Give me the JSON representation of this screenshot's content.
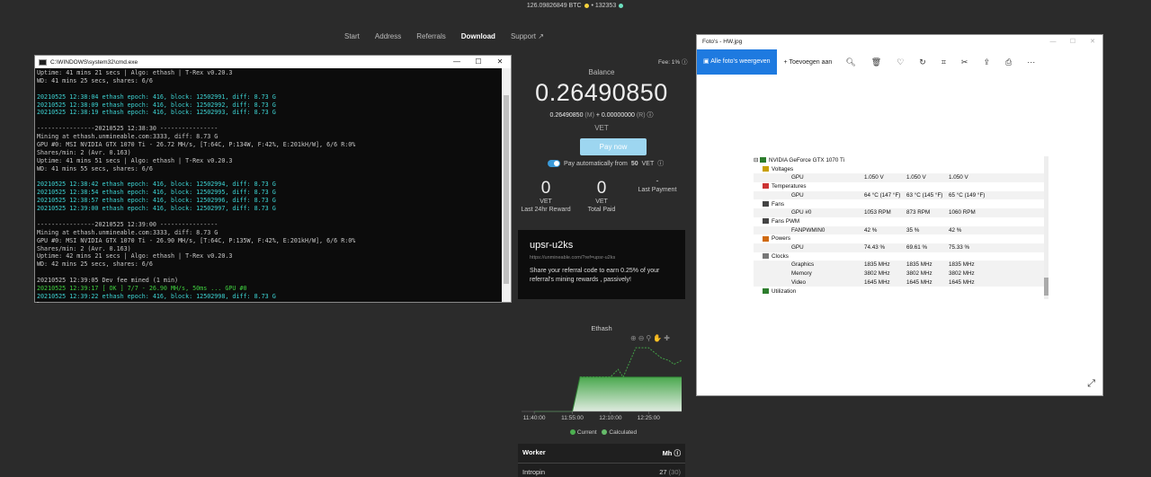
{
  "ticker": {
    "btc": "126.09826849 BTC",
    "sep": "•",
    "count": "132353"
  },
  "nav": {
    "items": [
      "Start",
      "Address",
      "Referrals",
      "Download",
      "Support"
    ]
  },
  "cmd": {
    "title": "C:\\WINDOWS\\system32\\cmd.exe",
    "lines": [
      {
        "t": "Uptime: 41 mins 21 secs | Algo: ethash | T-Rex v0.20.3",
        "c": "w"
      },
      {
        "t": "WD: 41 mins 25 secs, shares: 6/6",
        "c": "w"
      },
      {
        "t": "",
        "c": "w"
      },
      {
        "t": "20210525 12:38:04 ethash epoch: 416, block: 12502991, diff: 8.73 G",
        "c": "c"
      },
      {
        "t": "20210525 12:38:09 ethash epoch: 416, block: 12502992, diff: 8.73 G",
        "c": "c"
      },
      {
        "t": "20210525 12:38:19 ethash epoch: 416, block: 12502993, diff: 8.73 G",
        "c": "c"
      },
      {
        "t": "",
        "c": "w"
      },
      {
        "t": "----------------20210525 12:38:30 ----------------",
        "c": "w"
      },
      {
        "t": "Mining at ethash.unmineable.com:3333, diff: 8.73 G",
        "c": "w"
      },
      {
        "t": "GPU #0: MSI NVIDIA GTX 1070 Ti - 26.72 MH/s, [T:64C, P:134W, F:42%, E:201kH/W], 6/6 R:0%",
        "c": "w"
      },
      {
        "t": "Shares/min: 2 (Avr. 0.163)",
        "c": "w"
      },
      {
        "t": "Uptime: 41 mins 51 secs | Algo: ethash | T-Rex v0.20.3",
        "c": "w"
      },
      {
        "t": "WD: 41 mins 55 secs, shares: 6/6",
        "c": "w"
      },
      {
        "t": "",
        "c": "w"
      },
      {
        "t": "20210525 12:38:42 ethash epoch: 416, block: 12502994, diff: 8.73 G",
        "c": "c"
      },
      {
        "t": "20210525 12:38:54 ethash epoch: 416, block: 12502995, diff: 8.73 G",
        "c": "c"
      },
      {
        "t": "20210525 12:38:57 ethash epoch: 416, block: 12502996, diff: 8.73 G",
        "c": "c"
      },
      {
        "t": "20210525 12:39:00 ethash epoch: 416, block: 12502997, diff: 8.73 G",
        "c": "c"
      },
      {
        "t": "",
        "c": "w"
      },
      {
        "t": "----------------20210525 12:39:00 ----------------",
        "c": "w"
      },
      {
        "t": "Mining at ethash.unmineable.com:3333, diff: 8.73 G",
        "c": "w"
      },
      {
        "t": "GPU #0: MSI NVIDIA GTX 1070 Ti - 26.90 MH/s, [T:64C, P:135W, F:42%, E:201kH/W], 6/6 R:0%",
        "c": "w"
      },
      {
        "t": "Shares/min: 2 (Avr. 0.163)",
        "c": "w"
      },
      {
        "t": "Uptime: 42 mins 21 secs | Algo: ethash | T-Rex v0.20.3",
        "c": "w"
      },
      {
        "t": "WD: 42 mins 25 secs, shares: 6/6",
        "c": "w"
      },
      {
        "t": "",
        "c": "w"
      },
      {
        "t": "20210525 12:39:05 Dev fee mined (1 min)",
        "c": "w"
      },
      {
        "t": "20210525 12:39:17 [ OK ] 7/7 - 26.90 MH/s, 50ms ... GPU #0",
        "c": "g"
      },
      {
        "t": "20210525 12:39:22 ethash epoch: 416, block: 12502998, diff: 8.73 G",
        "c": "c"
      }
    ]
  },
  "balance": {
    "fee": "Fee: 1%",
    "label": "Balance",
    "value": "0.26490850",
    "sub_main": "0.26490850",
    "sub_m": "(M)",
    "sub_plus": "+ 0.00000000",
    "sub_r": "(R)",
    "unit": "VET",
    "pay_now": "Pay now",
    "autopay_prefix": "Pay automatically from",
    "autopay_amount": "50",
    "autopay_unit": "VET",
    "stats": [
      {
        "big": "0",
        "unit": "VET",
        "label": "Last 24hr Reward"
      },
      {
        "big": "0",
        "unit": "VET",
        "label": "Total Paid"
      },
      {
        "big": "-",
        "unit": "",
        "label": "Last Payment"
      }
    ]
  },
  "referral": {
    "code": "upsr-u2ks",
    "url": "https://unmineable.com/?ref=upsr-u2ks",
    "text": "Share your referral code to earn 0.25% of your referral's mining rewards , passively!"
  },
  "chart_data": {
    "type": "area",
    "title": "Ethash",
    "x_ticks": [
      "11:40:00",
      "11:55:00",
      "12:10:00",
      "12:25:00"
    ],
    "series": [
      {
        "name": "Current",
        "color": "#4caf50",
        "x": [
          "11:40",
          "11:55",
          "11:58",
          "12:10",
          "12:20",
          "12:25",
          "12:30",
          "12:35",
          "12:38"
        ],
        "values": [
          0,
          0,
          27,
          27,
          27,
          27,
          27,
          27,
          27
        ]
      },
      {
        "name": "Calculated",
        "color": "#66bb6a",
        "x": [
          "11:58",
          "12:05",
          "12:10",
          "12:13",
          "12:15",
          "12:20",
          "12:25",
          "12:30",
          "12:33",
          "12:35",
          "12:38"
        ],
        "values": [
          27,
          27,
          27,
          33,
          27,
          50,
          50,
          42,
          40,
          37,
          40
        ]
      }
    ],
    "legend": [
      "Current",
      "Calculated"
    ]
  },
  "workers": {
    "col_worker": "Worker",
    "col_mh": "Mh",
    "rows": [
      {
        "name": "Intropin",
        "mh": "27",
        "calc": "(30)"
      }
    ]
  },
  "photos": {
    "title": "Foto's - HW.jpg",
    "all_label": "Alle foto's weergeven",
    "add_label": "Toevoegen aan"
  },
  "hw": {
    "device": "NVIDIA GeForce GTX 1070 Ti",
    "rows": [
      {
        "indent": 1,
        "label": "Voltages",
        "icon": "volt",
        "vals": []
      },
      {
        "indent": 2,
        "label": "GPU",
        "icon": "",
        "vals": [
          "1.050 V",
          "1.050 V",
          "1.050 V"
        ]
      },
      {
        "indent": 1,
        "label": "Temperatures",
        "icon": "temp",
        "vals": []
      },
      {
        "indent": 2,
        "label": "GPU",
        "icon": "",
        "vals": [
          "64 °C  (147 °F)",
          "63 °C  (145 °F)",
          "65 °C  (149 °F)"
        ]
      },
      {
        "indent": 1,
        "label": "Fans",
        "icon": "fan",
        "vals": []
      },
      {
        "indent": 2,
        "label": "GPU #0",
        "icon": "",
        "vals": [
          "1053 RPM",
          "873 RPM",
          "1060 RPM"
        ]
      },
      {
        "indent": 1,
        "label": "Fans PWM",
        "icon": "fan",
        "vals": []
      },
      {
        "indent": 2,
        "label": "FANPWMIN0",
        "icon": "",
        "vals": [
          "42 %",
          "35 %",
          "42 %"
        ]
      },
      {
        "indent": 1,
        "label": "Powers",
        "icon": "power",
        "vals": []
      },
      {
        "indent": 2,
        "label": "GPU",
        "icon": "",
        "vals": [
          "74.43 %",
          "69.61 %",
          "75.33 %"
        ]
      },
      {
        "indent": 1,
        "label": "Clocks",
        "icon": "clock",
        "vals": []
      },
      {
        "indent": 2,
        "label": "Graphics",
        "icon": "",
        "vals": [
          "1835 MHz",
          "1835 MHz",
          "1835 MHz"
        ]
      },
      {
        "indent": 2,
        "label": "Memory",
        "icon": "",
        "vals": [
          "3802 MHz",
          "3802 MHz",
          "3802 MHz"
        ]
      },
      {
        "indent": 2,
        "label": "Video",
        "icon": "",
        "vals": [
          "1645 MHz",
          "1645 MHz",
          "1645 MHz"
        ]
      },
      {
        "indent": 1,
        "label": "Utilization",
        "icon": "util",
        "vals": []
      }
    ]
  },
  "colors": {
    "accent": "#1e7ae0",
    "pay": "#9dd6f0",
    "toggle": "#3a9ad9",
    "cyan": "#3dd4d4",
    "green": "#3fd03f"
  }
}
